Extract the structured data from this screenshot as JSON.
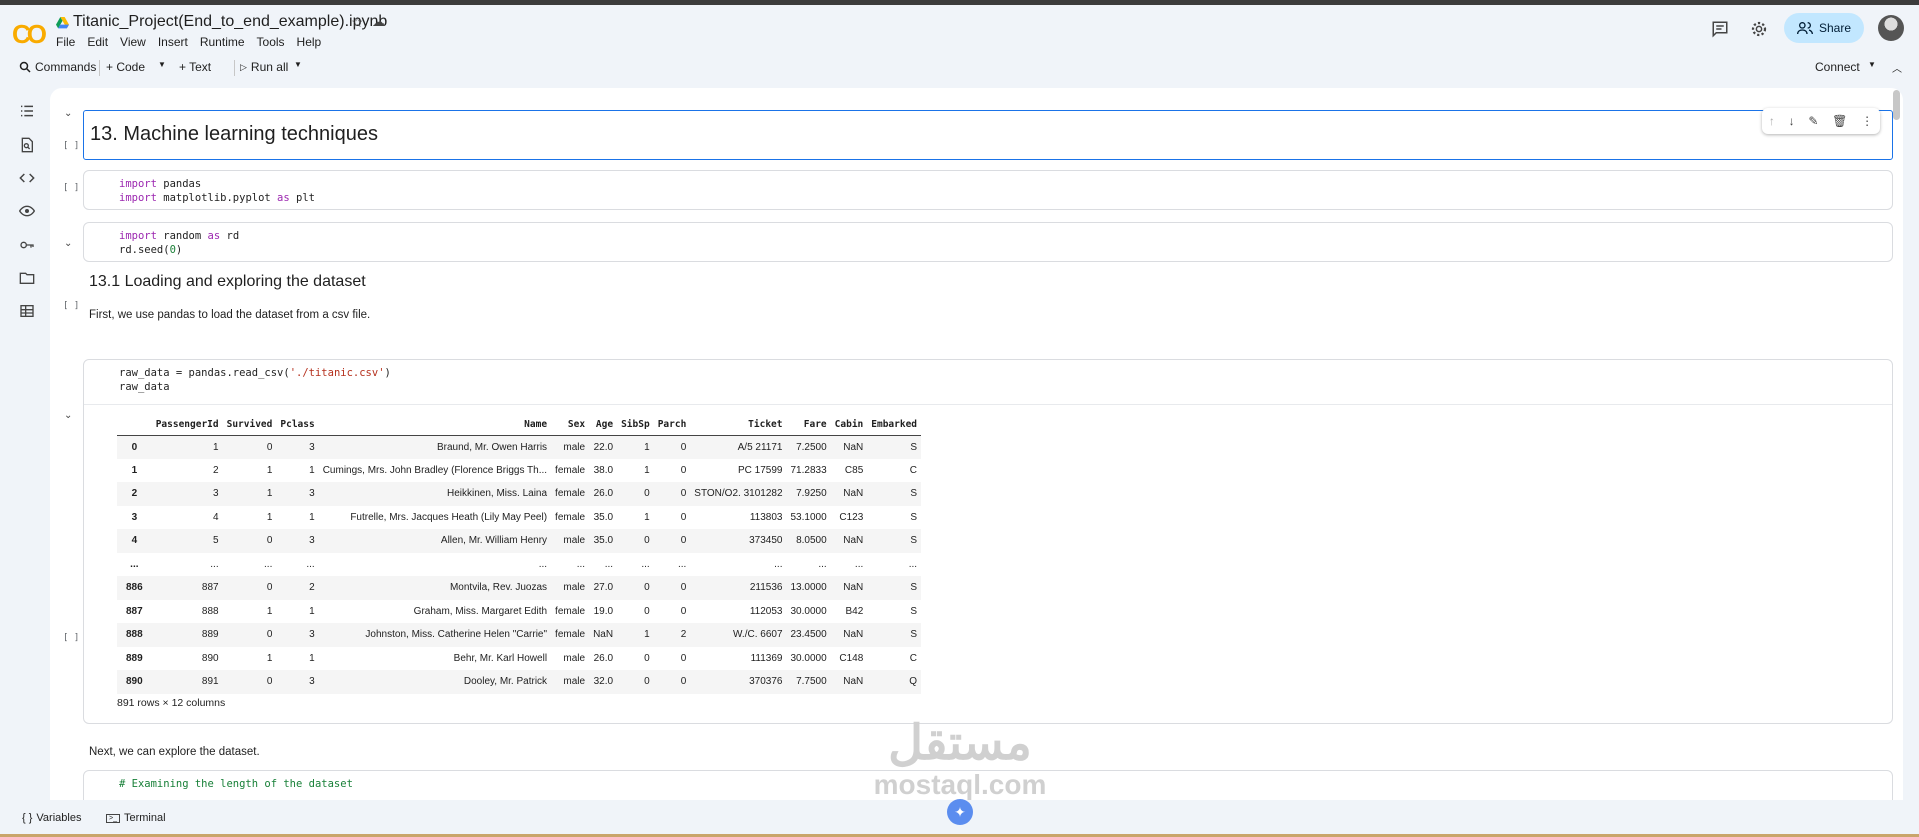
{
  "header": {
    "logo": "CO",
    "title": "Titanic_Project(End_to_end_example).ipynb",
    "menu": [
      "File",
      "Edit",
      "View",
      "Insert",
      "Runtime",
      "Tools",
      "Help"
    ],
    "share_label": "Share"
  },
  "toolbar": {
    "commands": "Commands",
    "code": "+ Code",
    "text": "+ Text",
    "run_all": "Run all",
    "connect": "Connect"
  },
  "cells": {
    "h1": "13. Machine learning techniques",
    "code1": [
      "import pandas",
      "import matplotlib.pyplot as plt"
    ],
    "code2": [
      "import random as rd",
      "rd.seed(0)"
    ],
    "h2": "13.1 Loading and exploring the dataset",
    "para1": "First, we use pandas to load the dataset from a csv file.",
    "code3_line1_a": "raw_data = pandas.read_csv(",
    "code3_line1_b": "'./titanic.csv'",
    "code3_line1_c": ")",
    "code3_line2": "raw_data",
    "para2": "Next, we can explore the dataset.",
    "code4": "# Examining the length of the dataset",
    "bracket": "[ ]",
    "row_info": "891 rows × 12 columns"
  },
  "dataframe": {
    "columns": [
      "",
      "PassengerId",
      "Survived",
      "Pclass",
      "Name",
      "Sex",
      "Age",
      "SibSp",
      "Parch",
      "Ticket",
      "Fare",
      "Cabin",
      "Embarked"
    ],
    "rows": [
      [
        "0",
        "1",
        "0",
        "3",
        "Braund, Mr. Owen Harris",
        "male",
        "22.0",
        "1",
        "0",
        "A/5 21171",
        "7.2500",
        "NaN",
        "S"
      ],
      [
        "1",
        "2",
        "1",
        "1",
        "Cumings, Mrs. John Bradley (Florence Briggs Th...",
        "female",
        "38.0",
        "1",
        "0",
        "PC 17599",
        "71.2833",
        "C85",
        "C"
      ],
      [
        "2",
        "3",
        "1",
        "3",
        "Heikkinen, Miss. Laina",
        "female",
        "26.0",
        "0",
        "0",
        "STON/O2. 3101282",
        "7.9250",
        "NaN",
        "S"
      ],
      [
        "3",
        "4",
        "1",
        "1",
        "Futrelle, Mrs. Jacques Heath (Lily May Peel)",
        "female",
        "35.0",
        "1",
        "0",
        "113803",
        "53.1000",
        "C123",
        "S"
      ],
      [
        "4",
        "5",
        "0",
        "3",
        "Allen, Mr. William Henry",
        "male",
        "35.0",
        "0",
        "0",
        "373450",
        "8.0500",
        "NaN",
        "S"
      ],
      [
        "...",
        "...",
        "...",
        "...",
        "...",
        "...",
        "...",
        "...",
        "...",
        "...",
        "...",
        "...",
        "..."
      ],
      [
        "886",
        "887",
        "0",
        "2",
        "Montvila, Rev. Juozas",
        "male",
        "27.0",
        "0",
        "0",
        "211536",
        "13.0000",
        "NaN",
        "S"
      ],
      [
        "887",
        "888",
        "1",
        "1",
        "Graham, Miss. Margaret Edith",
        "female",
        "19.0",
        "0",
        "0",
        "112053",
        "30.0000",
        "B42",
        "S"
      ],
      [
        "888",
        "889",
        "0",
        "3",
        "Johnston, Miss. Catherine Helen \"Carrie\"",
        "female",
        "NaN",
        "1",
        "2",
        "W./C. 6607",
        "23.4500",
        "NaN",
        "S"
      ],
      [
        "889",
        "890",
        "1",
        "1",
        "Behr, Mr. Karl Howell",
        "male",
        "26.0",
        "0",
        "0",
        "111369",
        "30.0000",
        "C148",
        "C"
      ],
      [
        "890",
        "891",
        "0",
        "3",
        "Dooley, Mr. Patrick",
        "male",
        "32.0",
        "0",
        "0",
        "370376",
        "7.7500",
        "NaN",
        "Q"
      ]
    ]
  },
  "statusbar": {
    "variables": "Variables",
    "terminal": "Terminal"
  },
  "watermark": {
    "arabic": "مستقل",
    "latin": "mostaql.com"
  },
  "colors": {
    "accent": "#1a73e8",
    "share_bg": "#c2e7ff",
    "logo": "#f9ab00"
  }
}
